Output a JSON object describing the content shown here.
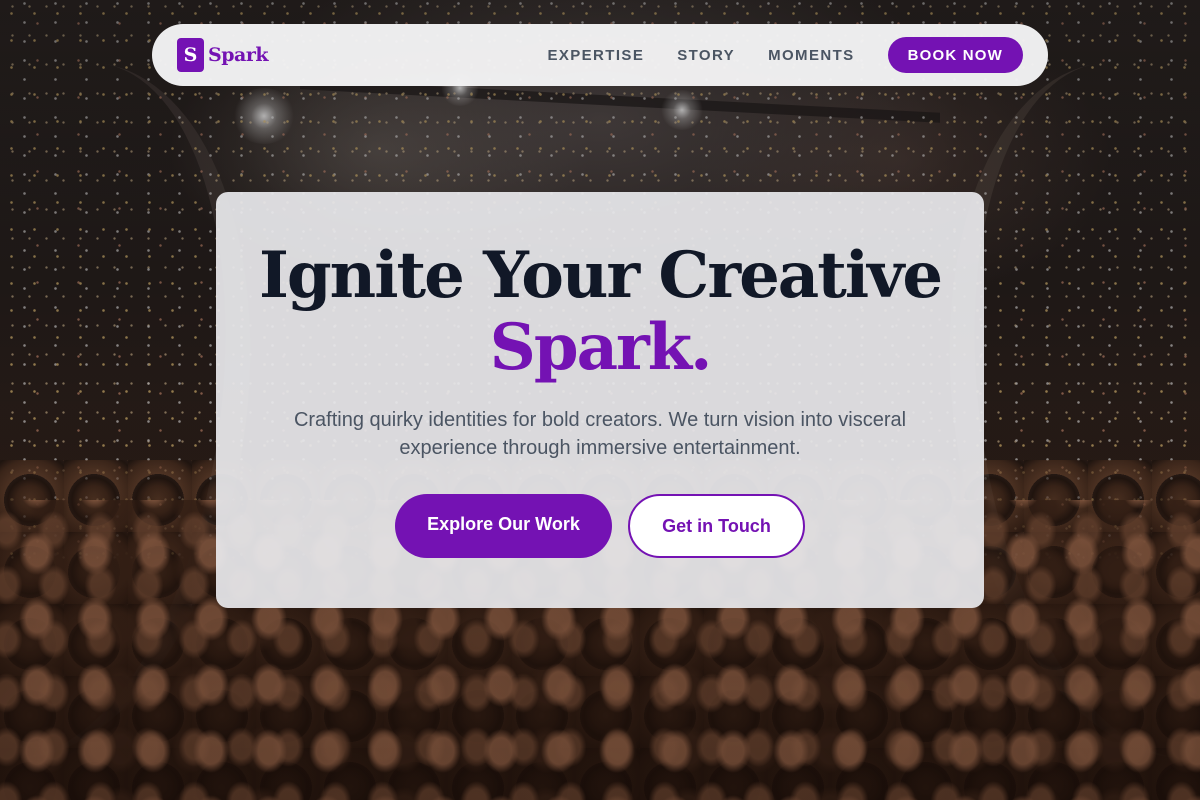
{
  "brand": {
    "mark": "S",
    "name": "Spark"
  },
  "nav": {
    "links": [
      {
        "label": "EXPERTISE"
      },
      {
        "label": "STORY"
      },
      {
        "label": "MOMENTS"
      }
    ],
    "cta_label": "BOOK NOW"
  },
  "hero": {
    "title_line1": "Ignite Your Creative",
    "title_line2": "Spark.",
    "subtitle": "Crafting quirky identities for bold creators. We turn vision into visceral experience through immersive entertainment.",
    "primary_button": "Explore Our Work",
    "secondary_button": "Get in Touch"
  },
  "theme": {
    "accent": "#7412b3",
    "heading": "#111827",
    "body_text": "#4b5563",
    "nav_background": "#f5f5f6",
    "card_background": "#e8e8ec"
  },
  "background_image": {
    "subject": "concert-crowd-with-confetti"
  }
}
